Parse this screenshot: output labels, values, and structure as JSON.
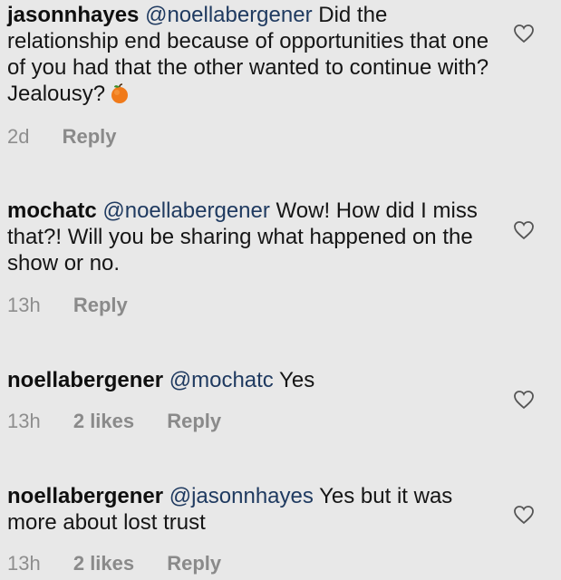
{
  "comments": [
    {
      "username": "jasonnhayes",
      "mention": "@noellabergener",
      "text": " Did the relationship end because of opportunities that one of you had that the other wanted to continue with? Jealousy?",
      "emoji": "tangerine-emoji",
      "time": "2d",
      "likes": "",
      "reply": "Reply",
      "heart_icon": "heart-outline-icon"
    },
    {
      "username": "mochatc",
      "mention": "@noellabergener",
      "text": " Wow!  How did I miss that?! Will you be sharing what happened on the show or no.",
      "time": "13h",
      "likes": "",
      "reply": "Reply",
      "heart_icon": "heart-outline-icon"
    },
    {
      "username": "noellabergener",
      "mention": "@mochatc",
      "text": " Yes",
      "time": "13h",
      "likes": "2 likes",
      "reply": "Reply",
      "heart_icon": "heart-outline-icon"
    },
    {
      "username": "noellabergener",
      "mention": "@jasonnhayes",
      "text": " Yes but it was more about lost trust",
      "time": "13h",
      "likes": "2 likes",
      "reply": "Reply",
      "heart_icon": "heart-outline-icon"
    }
  ],
  "colors": {
    "background": "#e8e8e8",
    "mention": "#1f3a60",
    "meta": "#8e8e8e"
  }
}
